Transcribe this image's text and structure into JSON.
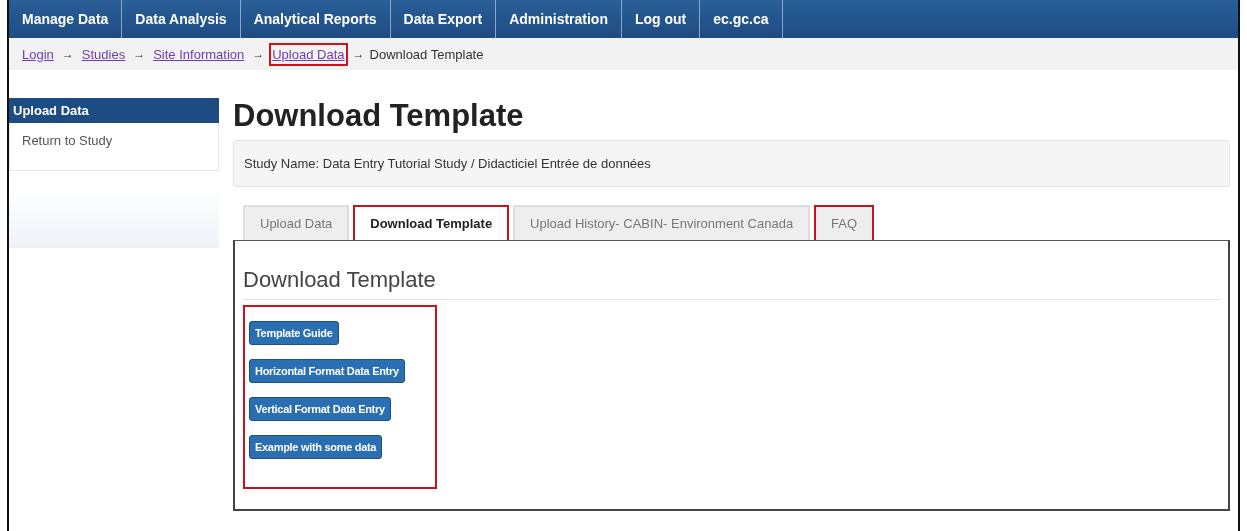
{
  "nav": [
    {
      "label": "Manage Data"
    },
    {
      "label": "Data Analysis"
    },
    {
      "label": "Analytical Reports"
    },
    {
      "label": "Data Export"
    },
    {
      "label": "Administration"
    },
    {
      "label": "Log out"
    },
    {
      "label": "ec.gc.ca"
    }
  ],
  "breadcrumb": {
    "links": [
      {
        "label": "Login",
        "highlighted": false
      },
      {
        "label": "Studies",
        "highlighted": false
      },
      {
        "label": "Site Information",
        "highlighted": false
      },
      {
        "label": "Upload Data",
        "highlighted": true
      }
    ],
    "separator": "→",
    "current": "Download Template"
  },
  "sidebar": {
    "header": "Upload Data",
    "items": [
      {
        "label": "Return to Study"
      }
    ]
  },
  "page_title": "Download Template",
  "study_name": "Study Name: Data Entry Tutorial Study / Didacticiel Entrée de données",
  "tabs": [
    {
      "label": "Upload Data",
      "selected": false,
      "highlighted": false
    },
    {
      "label": "Download Template",
      "selected": true,
      "highlighted": true
    },
    {
      "label": "Upload History- CABIN- Environment Canada",
      "selected": false,
      "highlighted": false
    },
    {
      "label": "FAQ",
      "selected": false,
      "highlighted": true
    }
  ],
  "panel": {
    "heading": "Download Template",
    "buttons_highlighted": true,
    "buttons": [
      {
        "label": "Template Guide"
      },
      {
        "label": "Horizontal Format Data Entry"
      },
      {
        "label": "Vertical Format Data Entry"
      },
      {
        "label": "Example with some data"
      }
    ]
  }
}
